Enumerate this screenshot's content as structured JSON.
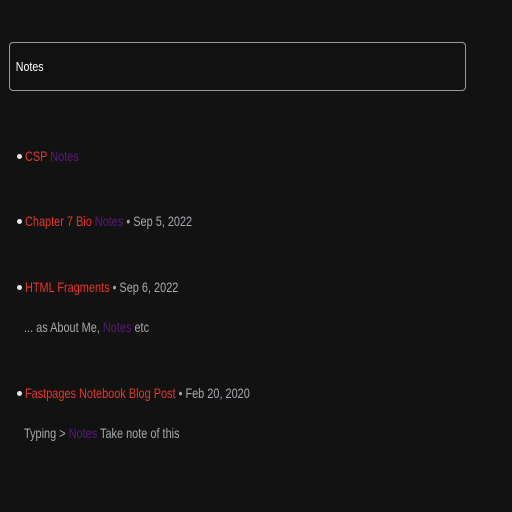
{
  "search": {
    "value": "Notes",
    "placeholder": ""
  },
  "results": [
    {
      "title": "CSP",
      "title_highlight": "Notes",
      "meta": "",
      "excerpt_before": "",
      "excerpt_highlight": "",
      "excerpt_after": ""
    },
    {
      "title": "Chapter 7 Bio",
      "title_highlight": "Notes",
      "meta": "• Sep 5, 2022",
      "excerpt_before": "",
      "excerpt_highlight": "",
      "excerpt_after": ""
    },
    {
      "title": "HTML Fragments",
      "title_highlight": "",
      "meta": "• Sep 6, 2022",
      "excerpt_before": "... as About Me,",
      "excerpt_highlight": "Notes",
      "excerpt_after": "etc"
    },
    {
      "title": "Fastpages Notebook Blog Post",
      "title_highlight": "",
      "meta": "• Feb 20, 2020",
      "excerpt_before": "Typing >",
      "excerpt_highlight": "Notes",
      "excerpt_after": "Take note of this"
    }
  ],
  "colors": {
    "background": "#121212",
    "link": "#e8352a",
    "highlight": "#5a1a7a",
    "meta": "#a8a8b0"
  }
}
